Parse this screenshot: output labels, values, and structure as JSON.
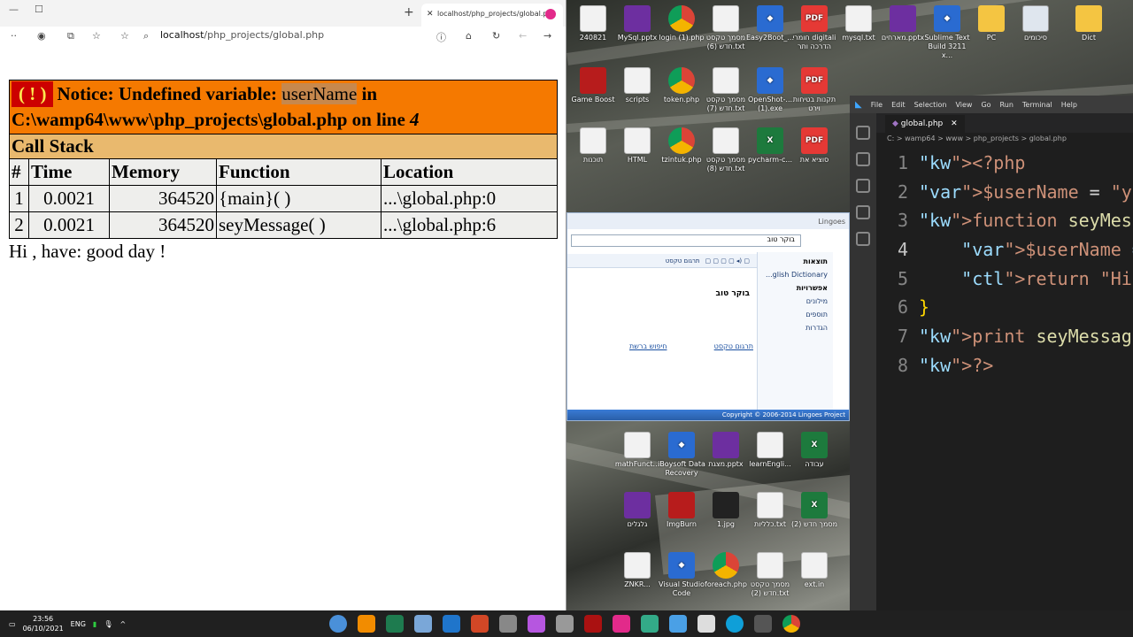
{
  "browser": {
    "tab_title": "localhost/php_projects/global.p",
    "url_host": "localhost",
    "url_path": "/php_projects/global.php",
    "notice_prefix": "Notice: Undefined variable: ",
    "notice_var": "userName",
    "notice_in": " in",
    "notice_path": "C:\\wamp64\\www\\php_projects\\global.php on line ",
    "notice_line": "4",
    "badge": "( ! )",
    "call_stack_label": "Call Stack",
    "columns": [
      "#",
      "Time",
      "Memory",
      "Function",
      "Location"
    ],
    "rows": [
      {
        "num": "1",
        "time": "0.0021",
        "memory": "364520",
        "function": "{main}( )",
        "location": "...\\global.php:0"
      },
      {
        "num": "2",
        "time": "0.0021",
        "memory": "364520",
        "function": "seyMessage( )",
        "location": "...\\global.php:6"
      }
    ],
    "output": "Hi , have: good day !"
  },
  "vscode": {
    "menu": [
      "File",
      "Edit",
      "Selection",
      "View",
      "Go",
      "Run",
      "Terminal",
      "Help"
    ],
    "tab": "global.php",
    "breadcrumb": "C: > wamp64 > www > php_projects > global.php",
    "active_line": 4,
    "lines": [
      {
        "n": "1",
        "text": "<?php"
      },
      {
        "n": "2",
        "text": "$userName = \"yo"
      },
      {
        "n": "3",
        "text": "function seyMes"
      },
      {
        "n": "4",
        "text": "    $userName ="
      },
      {
        "n": "5",
        "text": "    return \"Hi "
      },
      {
        "n": "6",
        "text": "}"
      },
      {
        "n": "7",
        "text": "print seyMessag"
      },
      {
        "n": "8",
        "text": "?>"
      }
    ]
  },
  "lingoes": {
    "title": "Lingoes",
    "search_text": "בוקר טוב",
    "word": "בוקר טוב",
    "side_results": "תוצאות",
    "side_dict": "...glish Dictionary",
    "side_options": "אפשרויות",
    "side_items": [
      "מילונים",
      "תוספים",
      "הגדרות"
    ],
    "toolbar_translate": "תרגום טקסט",
    "link_translate": "תרגום טקסט",
    "link_search": "חיפוש ברשת",
    "footer": "Copyright © 2006-2014 Lingoes Project"
  },
  "desktop": {
    "icons": [
      {
        "label": "240821",
        "kind": "file"
      },
      {
        "label": "MySql.pptx",
        "kind": "ppt"
      },
      {
        "label": "login (1).php",
        "kind": "chrome"
      },
      {
        "label": "מסמך טקסט חדש (6).txt",
        "kind": "file"
      },
      {
        "label": "Easy2Boot_...",
        "kind": "blue"
      },
      {
        "label": "חומרי digitali הדרכה ותר",
        "kind": "pdf"
      },
      {
        "label": "mysql.txt",
        "kind": "file"
      },
      {
        "label": "מארחים.pptx",
        "kind": "ppt"
      },
      {
        "label": "Sublime Text Build 3211 x...",
        "kind": "blue"
      },
      {
        "label": "PC",
        "kind": "folder"
      },
      {
        "label": "סיכומים",
        "kind": "doc"
      },
      {
        "label": "Dict",
        "kind": "folder"
      },
      {
        "label": "Game Boost",
        "kind": "red"
      },
      {
        "label": "scripts",
        "kind": "file"
      },
      {
        "label": "token.php",
        "kind": "chrome"
      },
      {
        "label": "מסמך טקסט חדש (7).txt",
        "kind": "file"
      },
      {
        "label": "OpenShot-... (1).exe",
        "kind": "blue"
      },
      {
        "label": "תקנות בטיחות וירט",
        "kind": "pdf"
      },
      {
        "label": "תוכנות",
        "kind": "file"
      },
      {
        "label": "HTML",
        "kind": "file"
      },
      {
        "label": "tzintuk.php",
        "kind": "chrome"
      },
      {
        "label": "מסמך טקסט חדש (8).txt",
        "kind": "file"
      },
      {
        "label": "pycharm-c...",
        "kind": "green"
      },
      {
        "label": "סוציא את",
        "kind": "pdf"
      },
      {
        "label": "mathFunct...",
        "kind": "file"
      },
      {
        "label": "iBoysoft Data Recovery",
        "kind": "blue"
      },
      {
        "label": "מצגת.pptx",
        "kind": "ppt"
      },
      {
        "label": "learnEngli...",
        "kind": "file"
      },
      {
        "label": "עבודה",
        "kind": "green"
      },
      {
        "label": "גלגלים",
        "kind": "ppt"
      },
      {
        "label": "ImgBurn",
        "kind": "red"
      },
      {
        "label": "1.jpg",
        "kind": "dark"
      },
      {
        "label": "כלליות.txt",
        "kind": "file"
      },
      {
        "label": "מסמך חדש (2)",
        "kind": "green"
      },
      {
        "label": "ZNKR...",
        "kind": "file"
      },
      {
        "label": "Visual Studio Code",
        "kind": "blue"
      },
      {
        "label": "foreach.php",
        "kind": "chrome"
      },
      {
        "label": "מסמך טקסט חדש (2).txt",
        "kind": "file"
      },
      {
        "label": "ext.in",
        "kind": "file"
      }
    ]
  },
  "taskbar": {
    "time": "23:56",
    "date": "06/10/2021",
    "lang": "ENG"
  }
}
